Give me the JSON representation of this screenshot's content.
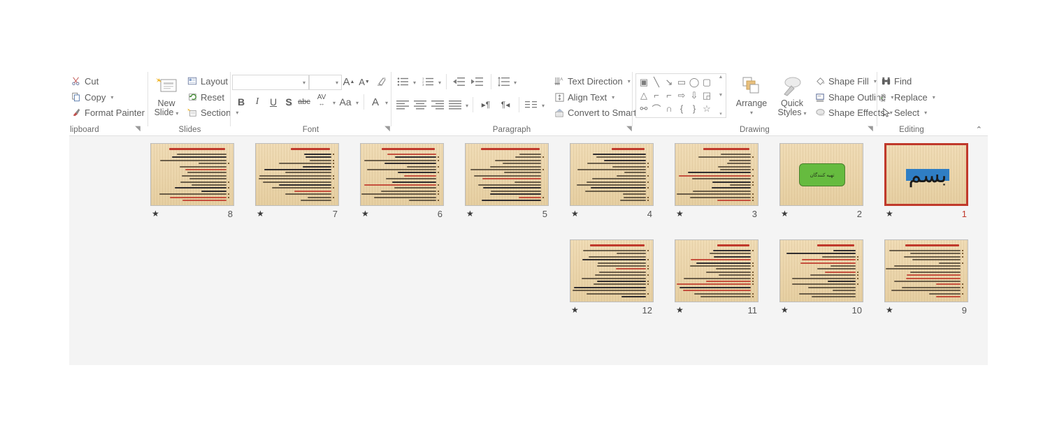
{
  "app": {
    "name": "PowerPoint Ribbon - Home Tab"
  },
  "ribbon": {
    "clipboard": {
      "title": "lipboard",
      "cut": "Cut",
      "copy": "Copy",
      "format_painter": "Format Painter",
      "dialog_launcher": "◥"
    },
    "slides": {
      "title": "Slides",
      "new_slide_line1": "New",
      "new_slide_line2": "Slide",
      "layout": "Layout",
      "reset": "Reset",
      "section": "Section"
    },
    "font": {
      "title": "Font",
      "font_name_value": "",
      "font_size_value": "",
      "increase_font": "A",
      "decrease_font": "A",
      "clear_formatting": "clear-format",
      "bold": "B",
      "italic": "I",
      "underline": "U",
      "shadow": "S",
      "strikethrough": "abc",
      "character_spacing": "AV",
      "change_case": "Aa",
      "font_color": "A",
      "dialog_launcher": "◥"
    },
    "paragraph": {
      "title": "Paragraph",
      "bullets": "bullets-icon",
      "numbering": "numbering-icon",
      "decrease_indent": "decrease-indent-icon",
      "increase_indent": "increase-indent-icon",
      "line_spacing": "line-spacing-icon",
      "align_left": "align-left-icon",
      "align_center": "align-center-icon",
      "align_right": "align-right-icon",
      "justify": "justify-icon",
      "ltr": "ltr-icon",
      "rtl": "rtl-icon",
      "columns": "columns-icon",
      "text_direction": "Text Direction",
      "align_text": "Align Text",
      "convert_to_smartart": "Convert to SmartArt",
      "dialog_launcher": "◥"
    },
    "drawing": {
      "title": "Drawing",
      "arrange": "Arrange",
      "quick_styles_line1": "Quick",
      "quick_styles_line2": "Styles",
      "shape_fill": "Shape Fill",
      "shape_outline": "Shape Outline",
      "shape_effects": "Shape Effects",
      "dialog_launcher": "◥",
      "shapes": [
        "▣",
        "╲",
        "↘",
        "▭",
        "◯",
        "▢",
        "△",
        "⌐",
        "⌐",
        "⇨",
        "⇩",
        "◲",
        "⚯",
        "⌒",
        "∩",
        "{",
        "}",
        "☆"
      ]
    },
    "editing": {
      "title": "Editing",
      "find": "Find",
      "replace": "Replace",
      "select": "Select"
    },
    "collapse_ribbon": "⌃"
  },
  "slide_pane": {
    "animation_star": "★",
    "row1": [
      {
        "number": "8",
        "type": "text",
        "selected": false
      },
      {
        "number": "7",
        "type": "text",
        "selected": false
      },
      {
        "number": "6",
        "type": "text",
        "selected": false
      },
      {
        "number": "5",
        "type": "text",
        "selected": false
      },
      {
        "number": "4",
        "type": "text",
        "selected": false
      },
      {
        "number": "3",
        "type": "text",
        "selected": false
      },
      {
        "number": "2",
        "type": "green",
        "selected": false,
        "box_label": "تهیه کنندگان"
      },
      {
        "number": "1",
        "type": "title",
        "selected": true,
        "calligraphy": "بسم"
      }
    ],
    "row2": [
      {
        "number": "12",
        "type": "text",
        "selected": false
      },
      {
        "number": "11",
        "type": "text",
        "selected": false
      },
      {
        "number": "10",
        "type": "text",
        "selected": false
      },
      {
        "number": "9",
        "type": "text",
        "selected": false
      }
    ]
  },
  "colors": {
    "selection_red": "#c0392b",
    "slide_paper": "#eed9b0",
    "green_shape": "#66bb3f",
    "blue_bar": "#2f7ec4",
    "pane_bg": "#f4f4f4",
    "ribbon_text": "#5e5e5e"
  }
}
